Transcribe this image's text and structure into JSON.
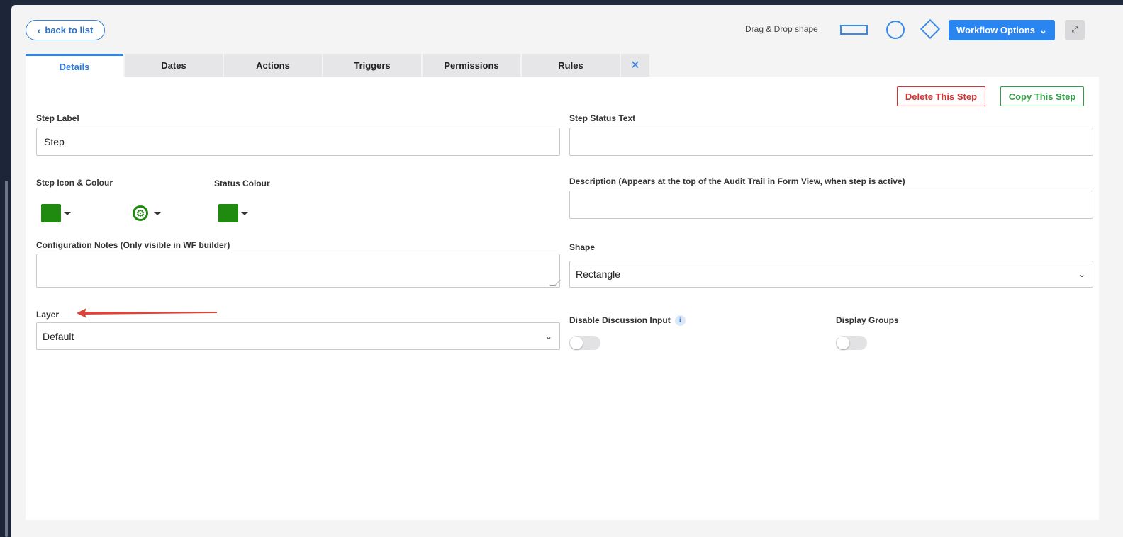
{
  "header": {
    "back_label": "back to list",
    "drag_drop_label": "Drag & Drop shape",
    "workflow_options_label": "Workflow Options"
  },
  "tabs": [
    {
      "label": "Details",
      "active": true
    },
    {
      "label": "Dates"
    },
    {
      "label": "Actions"
    },
    {
      "label": "Triggers"
    },
    {
      "label": "Permissions"
    },
    {
      "label": "Rules"
    },
    {
      "label": "✕"
    }
  ],
  "actions": {
    "delete_label": "Delete This Step",
    "copy_label": "Copy This Step"
  },
  "form": {
    "step_label": {
      "label": "Step Label",
      "value": "Step"
    },
    "step_status_text": {
      "label": "Step Status Text",
      "value": ""
    },
    "step_icon_colour": {
      "label": "Step Icon & Colour",
      "color": "#1f8a0f",
      "icon": "cog-refresh-icon"
    },
    "status_colour": {
      "label": "Status Colour",
      "color": "#1f8a0f"
    },
    "description": {
      "label": "Description (Appears at the top of the Audit Trail in Form View, when step is active)",
      "value": ""
    },
    "config_notes": {
      "label": "Configuration Notes (Only visible in WF builder)",
      "value": ""
    },
    "shape": {
      "label": "Shape",
      "value": "Rectangle"
    },
    "layer": {
      "label": "Layer",
      "value": "Default"
    },
    "disable_discussion": {
      "label": "Disable Discussion Input",
      "on": false
    },
    "display_groups": {
      "label": "Display Groups",
      "on": false
    }
  },
  "colors": {
    "accent": "#2b85f0",
    "danger": "#d23232",
    "success": "#2f9e44",
    "swatch_green": "#1f8a0f",
    "annotation_arrow": "#d9453a"
  }
}
